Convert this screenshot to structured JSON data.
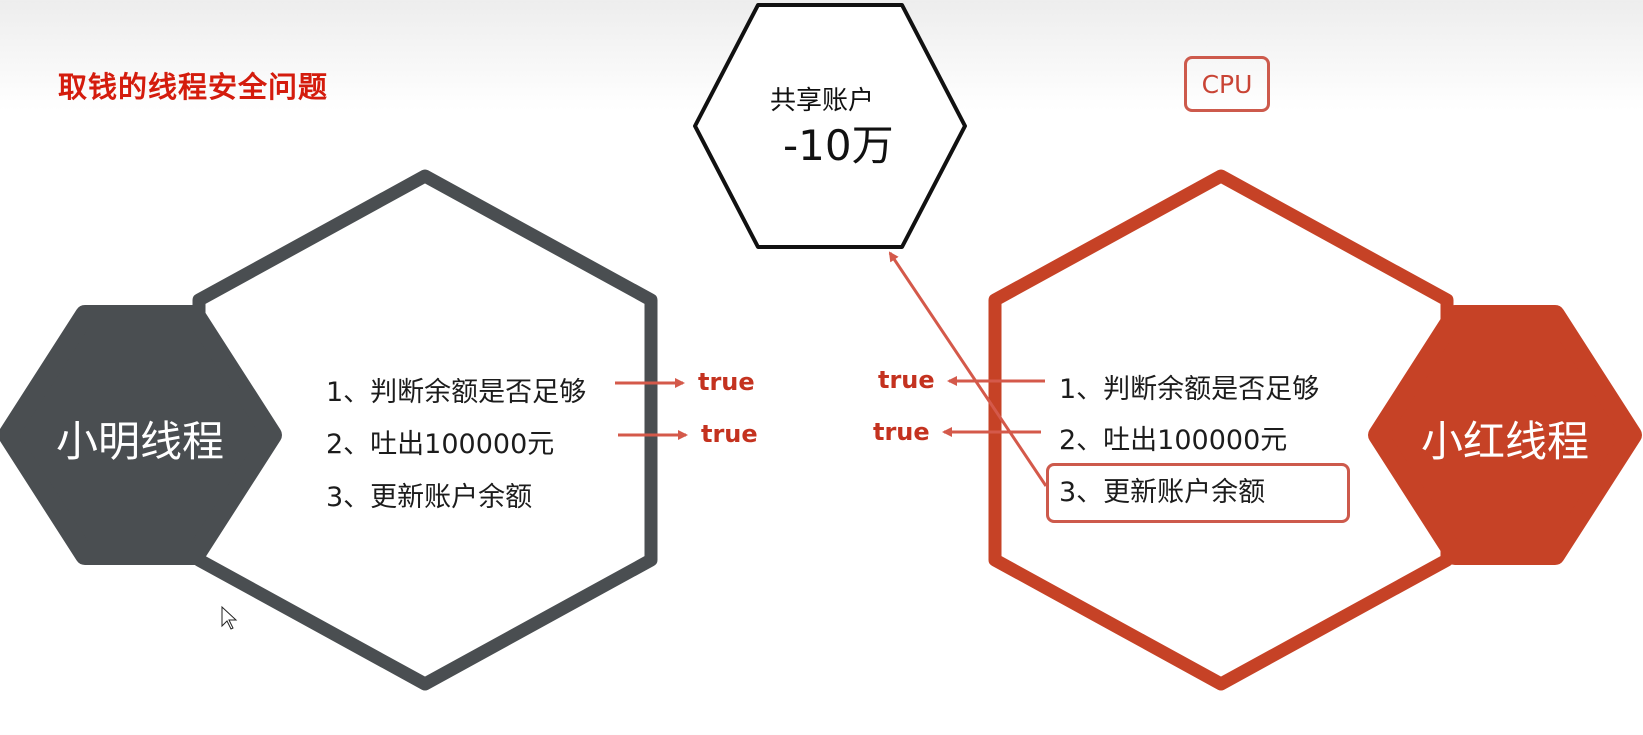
{
  "title": "取钱的线程安全问题",
  "cpu_label": "CPU",
  "shared_account": {
    "label": "共享账户",
    "amount": "-10万"
  },
  "left_thread": {
    "name": "小明线程",
    "steps": [
      "1、判断余额是否足够",
      "2、吐出100000元",
      "3、更新账户余额"
    ],
    "results": [
      "true",
      "true"
    ]
  },
  "right_thread": {
    "name": "小红线程",
    "steps": [
      "1、判断余额是否足够",
      "2、吐出100000元",
      "3、更新账户余额"
    ],
    "results": [
      "true",
      "true"
    ]
  },
  "colors": {
    "title": "#d41c0d",
    "left_accent": "#4a4e51",
    "right_accent": "#c64226",
    "arrow": "#d4594a",
    "shared_border": "#111111"
  }
}
